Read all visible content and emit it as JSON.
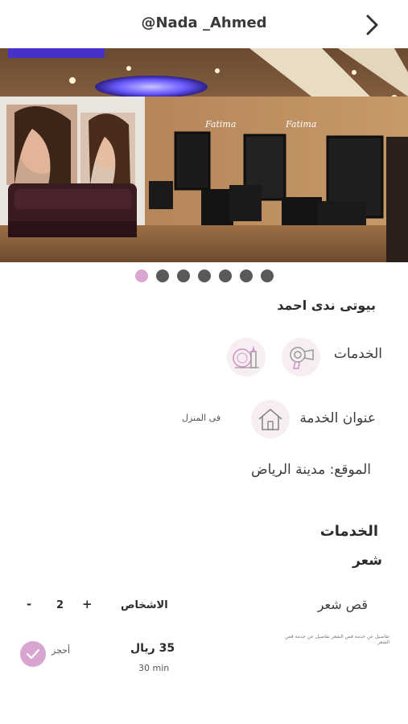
{
  "header": {
    "title": "@Nada _Ahmed",
    "back_icon": "chevron-right-icon"
  },
  "gallery": {
    "image_description_icon": "salon-photo",
    "slide_count": 7,
    "active_index": 0,
    "sign_text": "Fatima Beauty"
  },
  "salon": {
    "name": "بيوتى ندى احمد",
    "services_label": "الخدمات",
    "service_address_label": "عنوان الخدمة",
    "service_address_value": "فى المنزل",
    "location_label": "الموقع: مدينة الرياض"
  },
  "services_section": {
    "title": "الخدمات",
    "category": "شعر",
    "item": {
      "name": "قص شعر",
      "persons_label": "الاشخاص",
      "persons_count": "2",
      "plus_label": "+",
      "minus_label": "-",
      "description": "تفاصيل عن خدمة قص الشعر تفاصيل عن خدمة قص الشعر",
      "price": "35 ريال",
      "duration": "30 min",
      "book_label": "أحجز"
    }
  },
  "colors": {
    "accent": "#d8a6cf",
    "dot_inactive": "#595959"
  }
}
